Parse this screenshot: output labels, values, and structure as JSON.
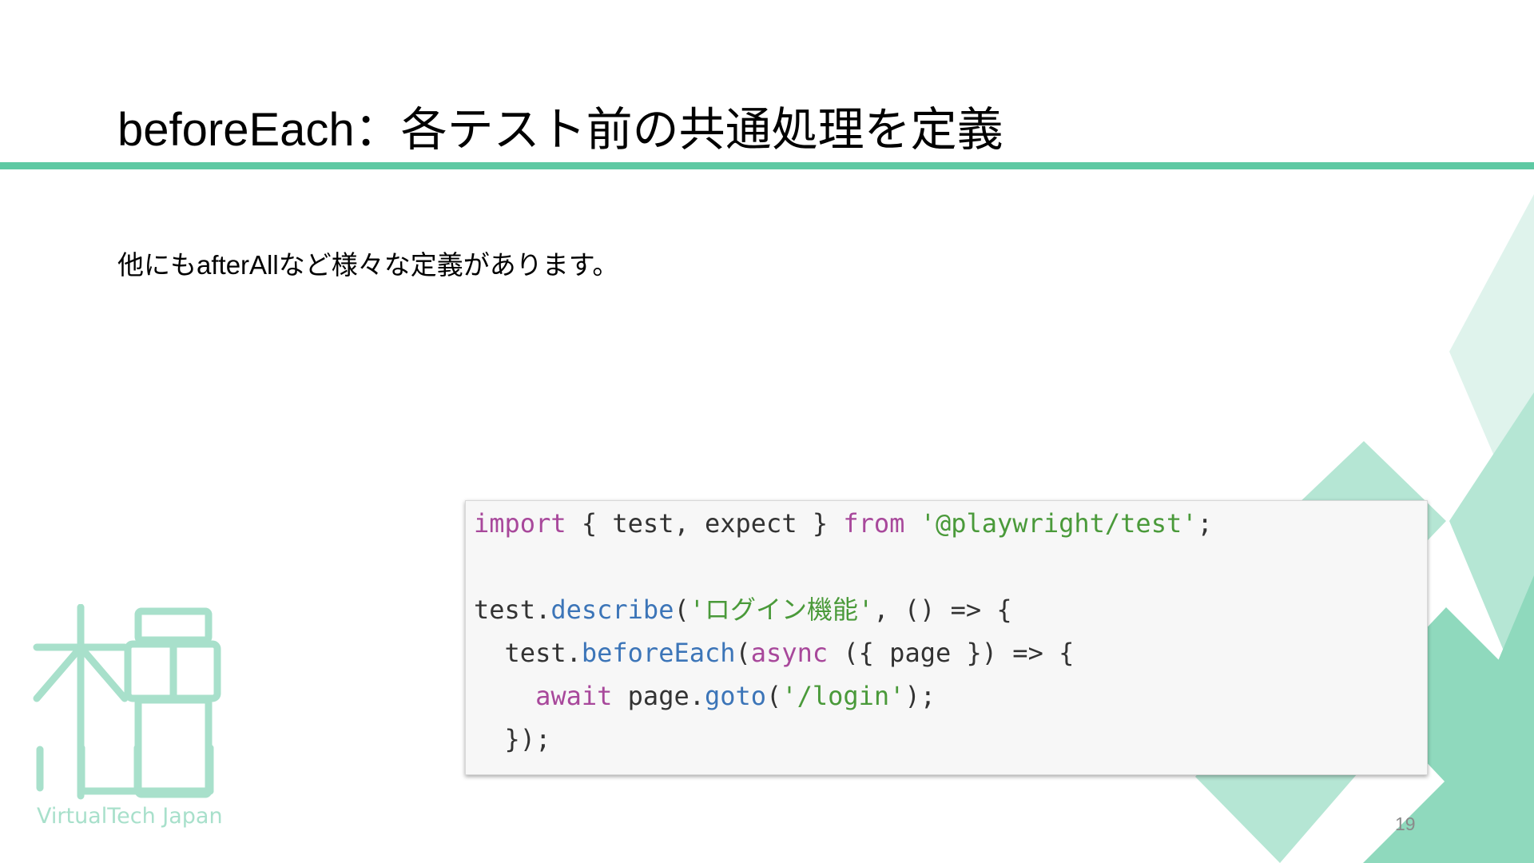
{
  "slide": {
    "title": "beforeEach：各テスト前の共通処理を定義",
    "subtitle": "他にもafterAllなど様々な定義があります。",
    "page_number": "19"
  },
  "code": {
    "lines": [
      [
        {
          "t": "import",
          "c": "kw"
        },
        {
          "t": " { test, expect } ",
          "c": "plain"
        },
        {
          "t": "from",
          "c": "kw"
        },
        {
          "t": " ",
          "c": "plain"
        },
        {
          "t": "'@playwright/test'",
          "c": "str"
        },
        {
          "t": ";",
          "c": "plain"
        }
      ],
      [],
      [
        {
          "t": "test.",
          "c": "plain"
        },
        {
          "t": "describe",
          "c": "fn"
        },
        {
          "t": "(",
          "c": "plain"
        },
        {
          "t": "'ログイン機能'",
          "c": "str"
        },
        {
          "t": ", () => {",
          "c": "plain"
        }
      ],
      [
        {
          "t": "  test.",
          "c": "plain"
        },
        {
          "t": "beforeEach",
          "c": "fn"
        },
        {
          "t": "(",
          "c": "plain"
        },
        {
          "t": "async",
          "c": "kw"
        },
        {
          "t": " ({ page }) => {",
          "c": "plain"
        }
      ],
      [
        {
          "t": "    ",
          "c": "plain"
        },
        {
          "t": "await",
          "c": "kw"
        },
        {
          "t": " page.",
          "c": "plain"
        },
        {
          "t": "goto",
          "c": "fn"
        },
        {
          "t": "(",
          "c": "plain"
        },
        {
          "t": "'/login'",
          "c": "str"
        },
        {
          "t": ");",
          "c": "plain"
        }
      ],
      [
        {
          "t": "  });",
          "c": "plain"
        }
      ]
    ]
  },
  "logo": {
    "text": "VirtualTech Japan",
    "icon": "virtualtech-logo-icon"
  },
  "colors": {
    "accent": "#5ec9a3",
    "decor_light": "#dff3ec",
    "decor_mid": "#b5e6d4",
    "decor_dark": "#8fd9bd",
    "logo": "#a8e0cb"
  }
}
